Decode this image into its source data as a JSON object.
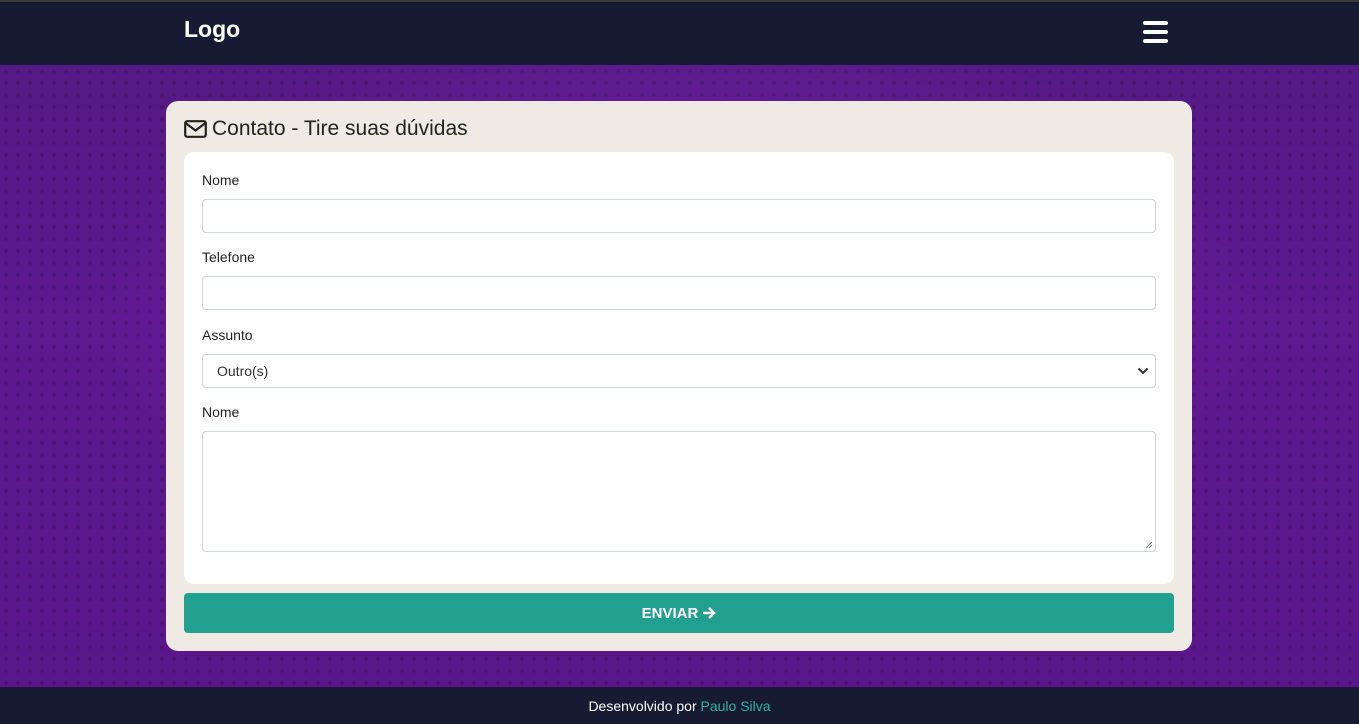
{
  "header": {
    "logo": "Logo",
    "menu_icon": "hamburger-icon"
  },
  "contact": {
    "title": "Contato - Tire suas dúvidas",
    "title_icon": "envelope-icon",
    "fields": {
      "name_label": "Nome",
      "name_value": "",
      "phone_label": "Telefone",
      "phone_value": "",
      "subject_label": "Assunto",
      "subject_selected": "Outro(s)",
      "message_label": "Nome",
      "message_value": ""
    },
    "submit_label": "ENVIAR",
    "submit_icon": "arrow-right-icon"
  },
  "footer": {
    "text": "Desenvolvido por",
    "author": "Paulo Silva"
  },
  "colors": {
    "nav_bg": "#161b33",
    "card_bg": "#efebe4",
    "accent": "#21a090",
    "link": "#2db3a1",
    "background": "#5e1890"
  }
}
